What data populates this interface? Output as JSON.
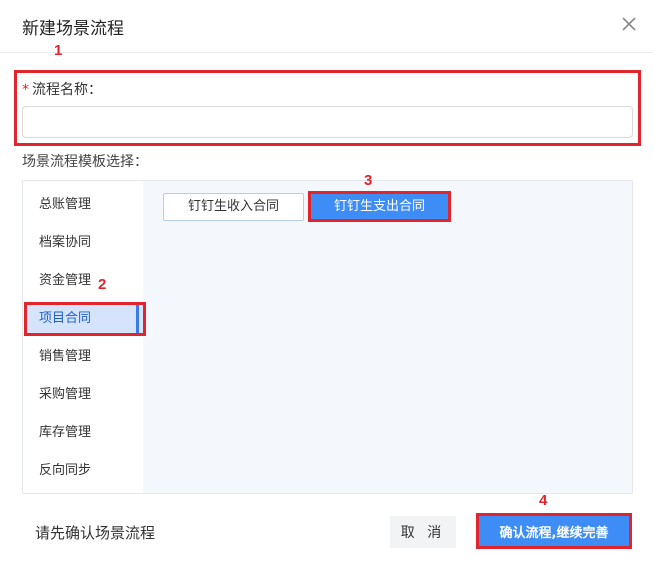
{
  "dialog": {
    "title": "新建场景流程",
    "close_icon": "close-icon"
  },
  "annotations": [
    "1",
    "2",
    "3",
    "4"
  ],
  "form": {
    "required_mark": "*",
    "name_label": "流程名称：",
    "name_value": "",
    "name_placeholder": ""
  },
  "templates": {
    "section_label": "场景流程模板选择：",
    "categories": [
      {
        "label": "总账管理",
        "active": false
      },
      {
        "label": "档案协同",
        "active": false
      },
      {
        "label": "资金管理",
        "active": false
      },
      {
        "label": "项目合同",
        "active": true
      },
      {
        "label": "销售管理",
        "active": false
      },
      {
        "label": "采购管理",
        "active": false
      },
      {
        "label": "库存管理",
        "active": false
      },
      {
        "label": "反向同步",
        "active": false
      }
    ],
    "items": [
      {
        "label": "钉钉生收入合同",
        "selected": false
      },
      {
        "label": "钉钉生支出合同",
        "selected": true
      }
    ]
  },
  "footer": {
    "hint": "请先确认场景流程",
    "cancel_label": "取 消",
    "confirm_label": "确认流程,继续完善"
  },
  "colors": {
    "primary": "#3e8cf5",
    "annotation": "#e0252c",
    "active_bg": "#d6e4fb"
  }
}
